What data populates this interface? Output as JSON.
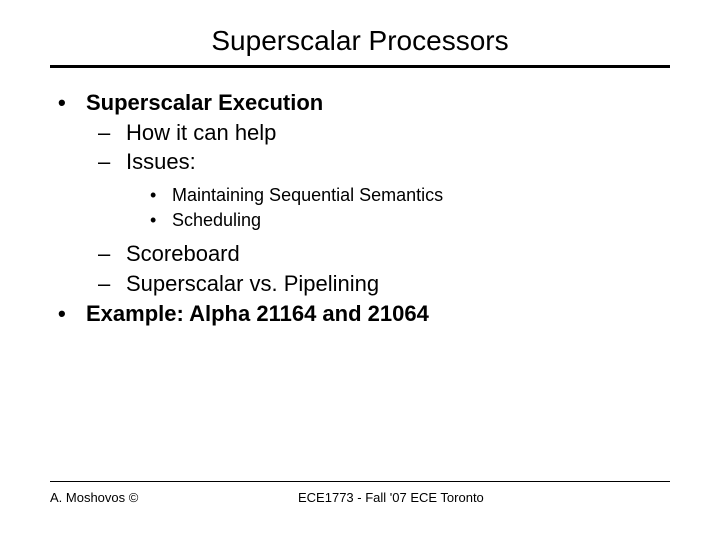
{
  "title": "Superscalar Processors",
  "items": [
    {
      "level": 1,
      "text": "Superscalar Execution"
    },
    {
      "level": 2,
      "text": "How it can help"
    },
    {
      "level": 2,
      "text": "Issues:"
    },
    {
      "level": 3,
      "text": "Maintaining Sequential Semantics"
    },
    {
      "level": 3,
      "text": "Scheduling"
    },
    {
      "level": 2,
      "text": "Scoreboard"
    },
    {
      "level": 2,
      "text": "Superscalar vs. Pipelining"
    },
    {
      "level": 1,
      "text": "Example: Alpha 21164 and 21064"
    }
  ],
  "footer": {
    "left": "A. Moshovos ©",
    "right": "ECE1773 - Fall '07 ECE Toronto"
  }
}
